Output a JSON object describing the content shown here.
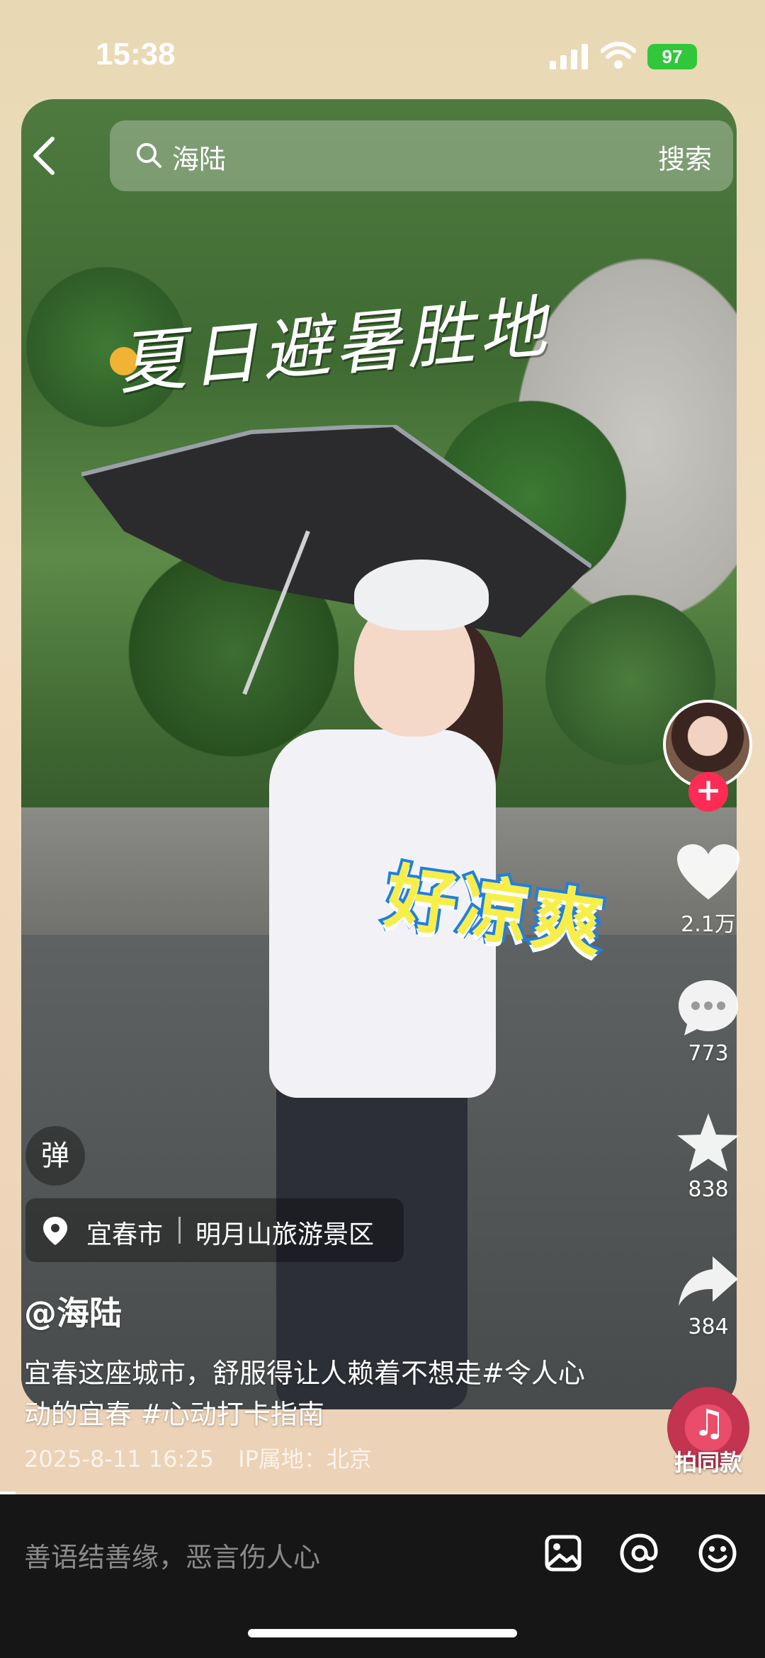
{
  "status_bar": {
    "time": "15:38",
    "battery": "97"
  },
  "search": {
    "query": "海陆",
    "button": "搜索"
  },
  "video": {
    "title_sticker": "夏日避暑胜地",
    "cool_sticker": "好凉爽",
    "progress_percent": 2
  },
  "side_rail": {
    "follow_label": "+",
    "likes": "2.1万",
    "comments": "773",
    "favorites": "838",
    "shares": "384",
    "music_label": "拍同款"
  },
  "info": {
    "danmu_label": "弹",
    "location_city": "宜春市",
    "location_spot": "明月山旅游景区",
    "author": "@海陆",
    "caption": "宜春这座城市，舒服得让人赖着不想走#令人心动的宜春 #心动打卡指南",
    "date": "2025-8-11 16:25",
    "ip": "IP属地：北京"
  },
  "comment_bar": {
    "placeholder": "善语结善缘，恶言伤人心"
  },
  "colors": {
    "follow": "#fe2c55",
    "battery": "#31c73b",
    "comment_bar": "#161616"
  }
}
